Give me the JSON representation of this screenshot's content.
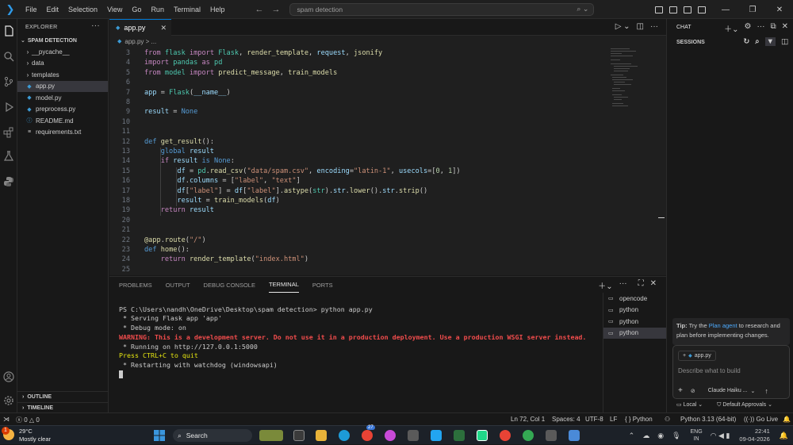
{
  "titlebar": {
    "menus": [
      "File",
      "Edit",
      "Selection",
      "View",
      "Go",
      "Run",
      "Terminal",
      "Help"
    ],
    "search_text": "spam detection"
  },
  "explorer": {
    "header": "EXPLORER",
    "project": "SPAM DETECTION",
    "items": [
      {
        "label": "__pycache__",
        "type": "folder"
      },
      {
        "label": "data",
        "type": "folder"
      },
      {
        "label": "templates",
        "type": "folder"
      },
      {
        "label": "app.py",
        "type": "python",
        "selected": true
      },
      {
        "label": "model.py",
        "type": "python"
      },
      {
        "label": "preprocess.py",
        "type": "python"
      },
      {
        "label": "README.md",
        "type": "info"
      },
      {
        "label": "requirements.txt",
        "type": "text"
      }
    ],
    "outline": "OUTLINE",
    "timeline": "TIMELINE"
  },
  "editor": {
    "tab_label": "app.py",
    "breadcrumb": "app.py > ...",
    "line_numbers": [
      "3",
      "4",
      "5",
      "6",
      "7",
      "8",
      "9",
      "10",
      "11",
      "12",
      "13",
      "14",
      "15",
      "16",
      "17",
      "18",
      "19",
      "20",
      "21",
      "22",
      "23",
      "24",
      "25"
    ]
  },
  "panel": {
    "tabs": [
      "PROBLEMS",
      "OUTPUT",
      "DEBUG CONSOLE",
      "TERMINAL",
      "PORTS"
    ],
    "active_tab": "TERMINAL",
    "terminal_lines": [
      "PS C:\\Users\\nandh\\OneDrive\\Desktop\\spam detection> python app.py",
      " * Serving Flask app 'app'",
      " * Debug mode: on",
      "WARNING: This is a development server. Do not use it in a production deployment. Use a production WSGI server instead.",
      " * Running on http://127.0.0.1:5000",
      "Press CTRL+C to quit",
      " * Restarting with watchdog (windowsapi)"
    ],
    "terminals": [
      "opencode",
      "python",
      "python",
      "python"
    ]
  },
  "chat": {
    "header": "CHAT",
    "sessions": "SESSIONS",
    "tip_prefix": "Tip:",
    "tip_pre": "Try the",
    "tip_link": "Plan agent",
    "tip_post": "to research and plan before implementing changes.",
    "context_file": "app.py",
    "input_placeholder": "Describe what to build",
    "model": "Claude Haiku ...",
    "local": "Local",
    "approvals": "Default Approvals"
  },
  "statusbar": {
    "errors": "0",
    "warnings": "0",
    "position": "Ln 72, Col 1",
    "spaces": "Spaces: 4",
    "encoding": "UTF-8",
    "eol": "LF",
    "language": "Python",
    "interpreter": "Python 3.13 (64-bit)",
    "golive": "Go Live"
  },
  "taskbar": {
    "temp": "29°C",
    "weather": "Mostly clear",
    "weather_badge": "1",
    "search": "Search",
    "lang_top": "ENG",
    "lang_bottom": "IN",
    "time": "22:41",
    "date": "09-04-2026",
    "chrome_badge": "27"
  },
  "colors": {
    "accent": "#0078d4",
    "editor_bg": "#1f1f1f",
    "warning_red": "#f14c4c"
  }
}
